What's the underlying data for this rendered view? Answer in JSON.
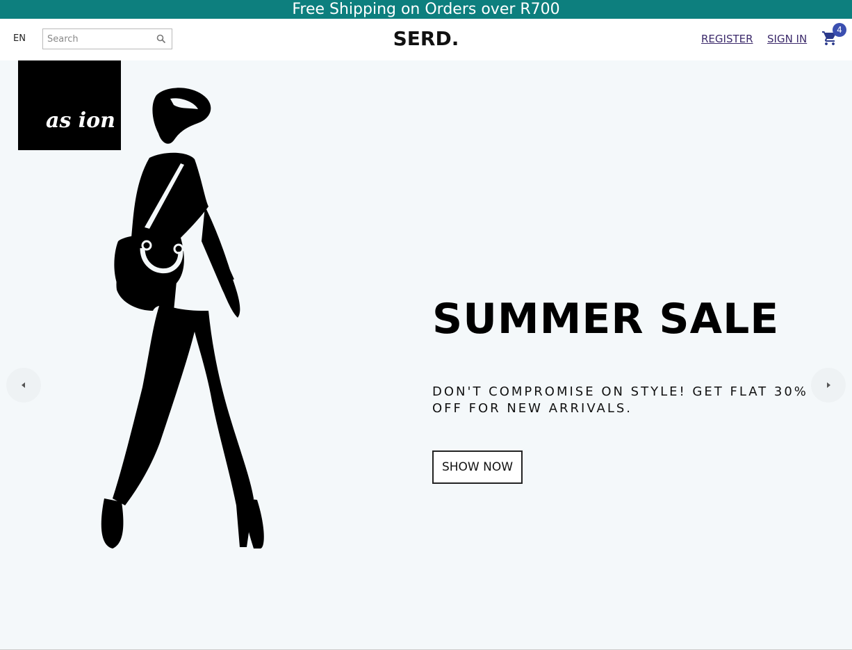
{
  "promo": {
    "text": "Free Shipping on Orders over R700"
  },
  "header": {
    "language": "EN",
    "search_placeholder": "Search",
    "logo": "SERD.",
    "register": "REGISTER",
    "signin": "SIGN IN",
    "cart_count": "4",
    "cart_icon": "shopping-cart-icon",
    "search_icon": "magnifier-icon"
  },
  "hero": {
    "brand_mark": "as ion",
    "title": "SUMMER SALE",
    "subtitle": "DON'T COMPROMISE ON STYLE! GET FLAT 30% OFF FOR NEW ARRIVALS.",
    "cta": "SHOW NOW",
    "prev_icon": "arrow-left-icon",
    "next_icon": "arrow-right-icon"
  },
  "colors": {
    "promo_bg": "#0d7f7e",
    "hero_bg": "#f4f8fa",
    "cart_badge": "#3b4fb0",
    "nav_link": "#3c2a6b"
  }
}
